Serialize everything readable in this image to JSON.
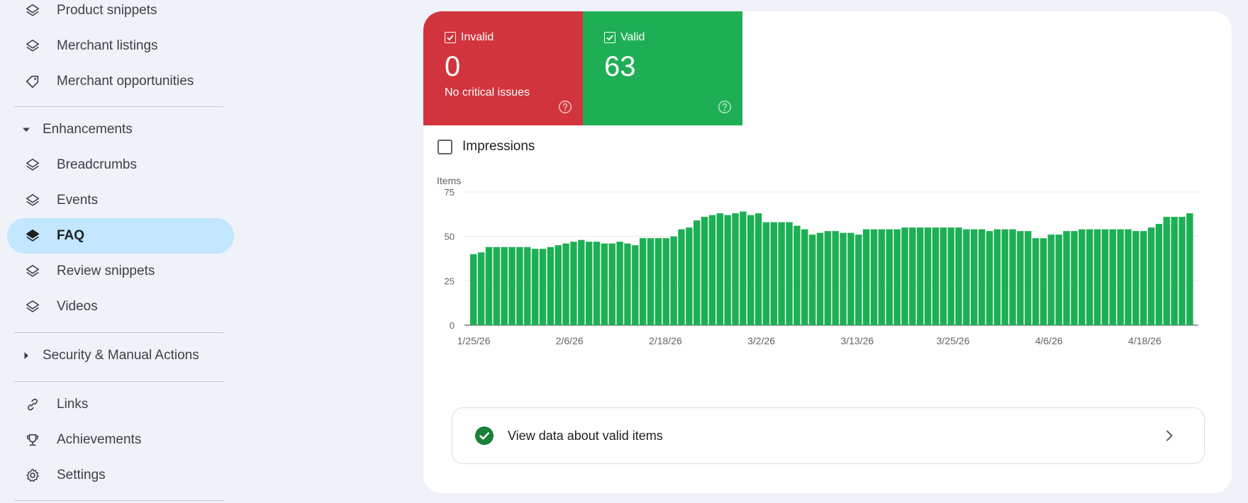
{
  "sidebar": {
    "top_items": [
      {
        "label": "Product snippets",
        "icon": "layers-icon"
      },
      {
        "label": "Merchant listings",
        "icon": "layers-icon"
      },
      {
        "label": "Merchant opportunities",
        "icon": "tag-icon"
      }
    ],
    "enhancements": {
      "label": "Enhancements",
      "items": [
        {
          "label": "Breadcrumbs",
          "icon": "layers-icon"
        },
        {
          "label": "Events",
          "icon": "layers-icon"
        },
        {
          "label": "FAQ",
          "icon": "layers-icon",
          "active": true
        },
        {
          "label": "Review snippets",
          "icon": "layers-icon"
        },
        {
          "label": "Videos",
          "icon": "layers-icon"
        }
      ]
    },
    "security": {
      "label": "Security & Manual Actions"
    },
    "bottom_items": [
      {
        "label": "Links",
        "icon": "link-icon"
      },
      {
        "label": "Achievements",
        "icon": "trophy-icon"
      },
      {
        "label": "Settings",
        "icon": "gear-icon"
      }
    ]
  },
  "status": {
    "invalid": {
      "label": "Invalid",
      "count": "0",
      "sub": "No critical issues",
      "color": "#d2343d"
    },
    "valid": {
      "label": "Valid",
      "count": "63",
      "color": "#1eaf55"
    }
  },
  "impressions_label": "Impressions",
  "valid_link_label": "View data about valid items",
  "chart_data": {
    "type": "bar",
    "ylabel": "Items",
    "ylim": [
      0,
      75
    ],
    "yticks": [
      0,
      25,
      50,
      75
    ],
    "grid": true,
    "color": "#1eaf55",
    "x_tick_labels": [
      "1/25/26",
      "2/6/26",
      "2/18/26",
      "3/2/26",
      "3/13/26",
      "3/25/26",
      "4/6/26",
      "4/18/26"
    ],
    "values": [
      40,
      41,
      44,
      44,
      44,
      44,
      44,
      44,
      43,
      43,
      44,
      45,
      46,
      47,
      48,
      47,
      47,
      46,
      46,
      47,
      46,
      45,
      49,
      49,
      49,
      49,
      50,
      54,
      55,
      59,
      61,
      62,
      63,
      62,
      63,
      64,
      62,
      63,
      58,
      58,
      58,
      58,
      56,
      54,
      51,
      52,
      53,
      53,
      52,
      52,
      51,
      54,
      54,
      54,
      54,
      54,
      55,
      55,
      55,
      55,
      55,
      55,
      55,
      55,
      54,
      54,
      54,
      53,
      54,
      54,
      54,
      53,
      53,
      49,
      49,
      51,
      51,
      53,
      53,
      54,
      54,
      54,
      54,
      54,
      54,
      54,
      53,
      53,
      55,
      57,
      61,
      61,
      61,
      63
    ]
  }
}
